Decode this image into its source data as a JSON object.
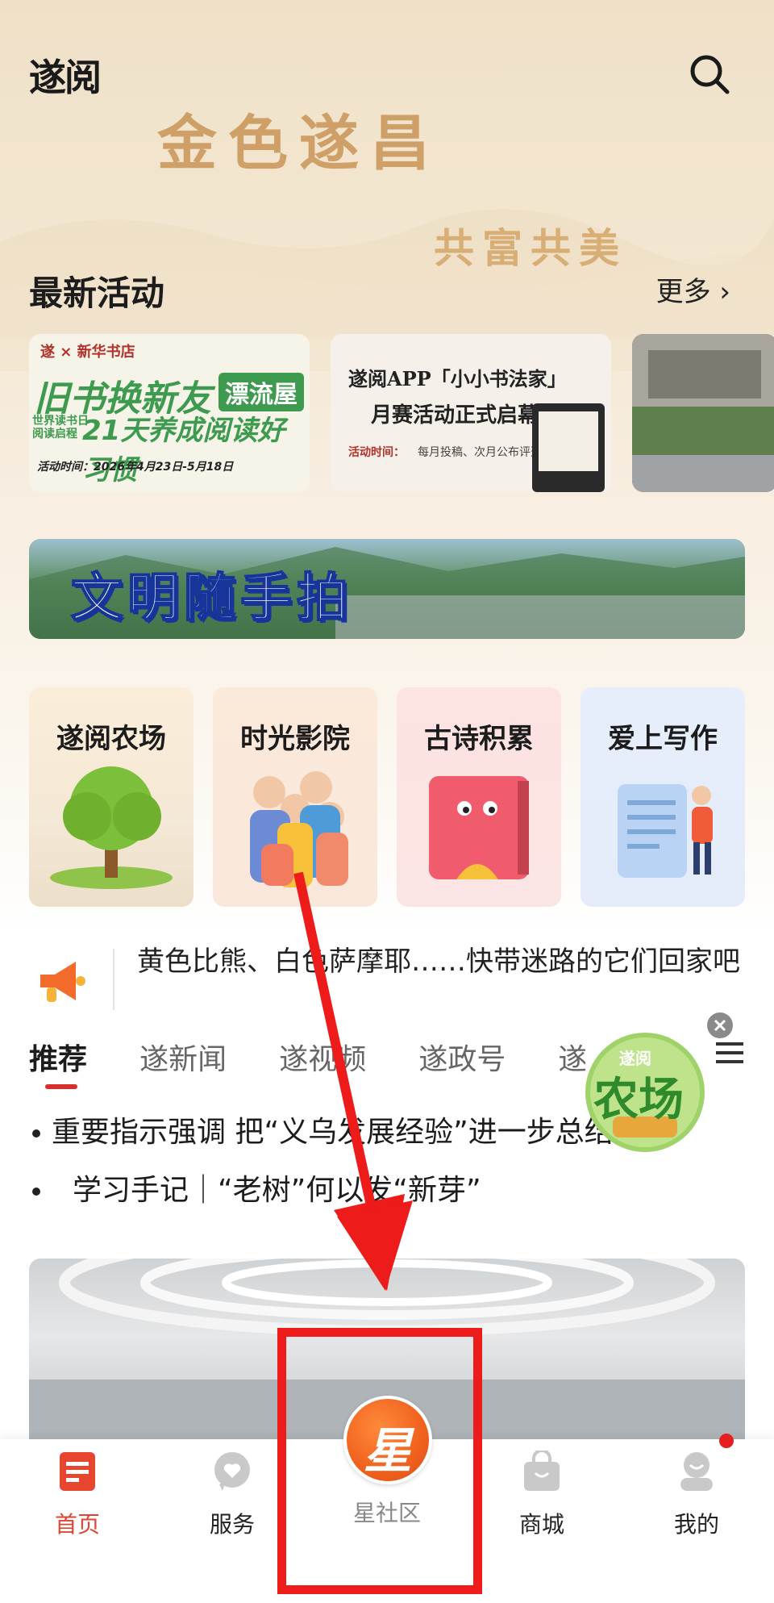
{
  "header": {
    "logo": "遂阅",
    "headline": "金色遂昌",
    "subheadline": "共富共美"
  },
  "activities": {
    "title": "最新活动",
    "more": "更多 ›",
    "card1": {
      "brand": "遂 × 新华书店",
      "main": "旧书换新友",
      "badge": "漂流屋",
      "sub_left": "世界读书日 阅读启程",
      "sub": "21天养成阅读好习惯",
      "date": "活动时间：2026年4月23日-5月18日"
    },
    "card2": {
      "line1": "遂阅APP「小小书法家」",
      "line2": "月赛活动正式启幕!",
      "label": "活动时间：",
      "note": "每月投稿、次月公布评选结果"
    }
  },
  "banner": {
    "text": "文明随手拍"
  },
  "tiles": [
    {
      "title": "遂阅农场"
    },
    {
      "title": "时光影院"
    },
    {
      "title": "古诗积累"
    },
    {
      "title": "爱上写作"
    }
  ],
  "announcement": {
    "text": "黄色比熊、白色萨摩耶……快带迷路的它们回家吧"
  },
  "tabs": [
    "推荐",
    "遂新闻",
    "遂视频",
    "遂政号",
    "遂报"
  ],
  "farm_badge": {
    "top": "遂阅",
    "main": "农场"
  },
  "news": [
    "重要指示强调 把“义乌发展经验”进一步总结好运",
    "学习手记｜“老树”何以发“新芽”"
  ],
  "nav": {
    "home": "首页",
    "service": "服务",
    "star_char": "星",
    "community": "星社区",
    "mall": "商城",
    "mine": "我的"
  },
  "colors": {
    "accent": "#e04433",
    "highlight": "#ee1b1b",
    "star": "#f0611d"
  }
}
